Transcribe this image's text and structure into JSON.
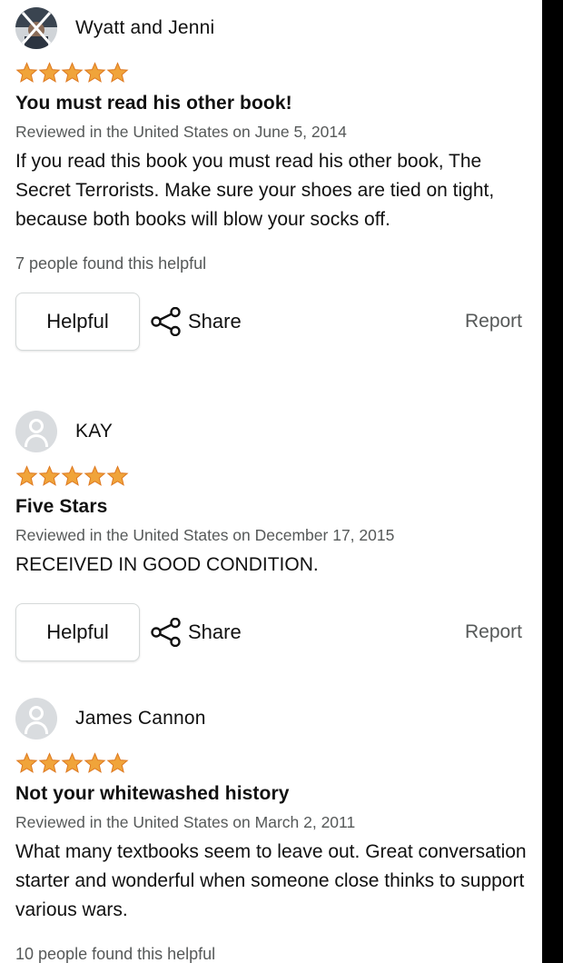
{
  "colors": {
    "star": "#f0a43a",
    "star_stroke": "#de7921",
    "secondary_text": "#565959",
    "avatar_bg": "#d9dcdf"
  },
  "actions": {
    "helpful_label": "Helpful",
    "share_label": "Share",
    "report_label": "Report",
    "share_icon": "share-icon"
  },
  "reviews": [
    {
      "reviewer": "Wyatt and Jenni",
      "avatar": "photo",
      "rating": 5,
      "title": "You must read his other book!",
      "date": "Reviewed in the United States on June 5, 2014",
      "body": "If you read this book you must read his other book, The Secret Terrorists. Make sure your shoes are tied on tight, because both books will blow your socks off.",
      "helpful": "7 people found this helpful"
    },
    {
      "reviewer": "KAY",
      "avatar": "default",
      "rating": 5,
      "title": "Five Stars",
      "date": "Reviewed in the United States on December 17, 2015",
      "body": "RECEIVED IN GOOD CONDITION.",
      "helpful": ""
    },
    {
      "reviewer": "James Cannon",
      "avatar": "default",
      "rating": 5,
      "title": "Not your whitewashed history",
      "date": "Reviewed in the United States on March 2, 2011",
      "body": "What many textbooks seem to leave out. Great conversation starter and wonderful when someone close thinks to support various wars.",
      "helpful": "10 people found this helpful"
    }
  ]
}
